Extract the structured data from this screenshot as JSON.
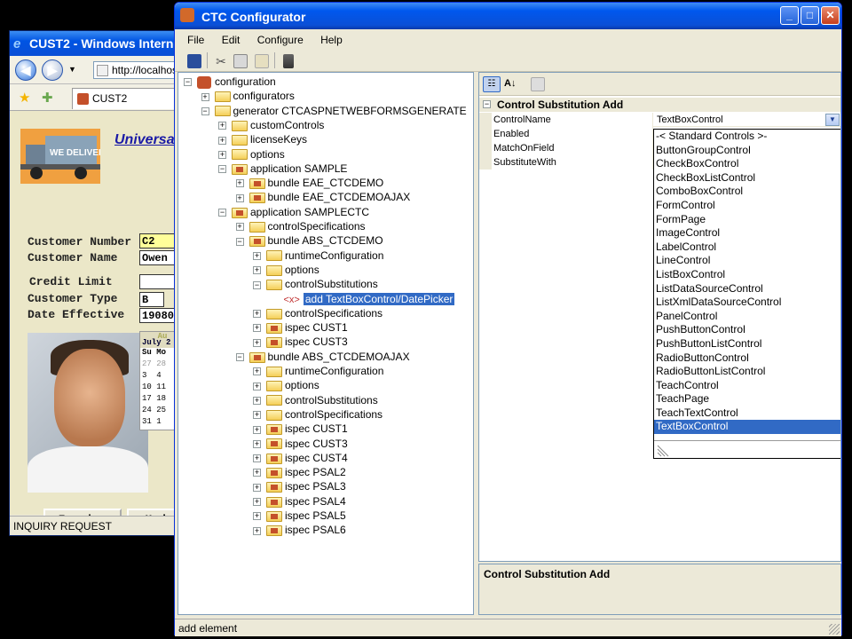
{
  "ie": {
    "title": "CUST2 - Windows Interne",
    "address": "http://localhost",
    "tab": "CUST2",
    "heading": "Universa",
    "fields": [
      {
        "label": "Customer Number",
        "value": "C2"
      },
      {
        "label": "Customer Name",
        "value": "Owen"
      },
      {
        "label": "Credit Limit",
        "value": ""
      },
      {
        "label": "Customer Type",
        "value": "B"
      },
      {
        "label": "Date Effective",
        "value": "19080"
      }
    ],
    "calendar": {
      "month": "Au",
      "month_year": "July 2",
      "rows": [
        "Su Mo",
        "27 28",
        "3  4",
        "10 11",
        "17 18",
        "24 25",
        "31 1"
      ]
    },
    "buttons": {
      "inquire": "Inquire",
      "update": "Updat"
    },
    "status": "INQUIRY REQUEST"
  },
  "ctc": {
    "title": "CTC Configurator",
    "menu": [
      "File",
      "Edit",
      "Configure",
      "Help"
    ],
    "tree": [
      {
        "label": "configuration",
        "indent": 0,
        "icon": "cfg",
        "pm": "−"
      },
      {
        "label": "configurators",
        "indent": 1,
        "icon": "fld",
        "pm": "+"
      },
      {
        "label": "generator CTCASPNETWEBFORMSGENERATE",
        "indent": 1,
        "icon": "fld",
        "pm": "−"
      },
      {
        "label": "customControls",
        "indent": 2,
        "icon": "fld",
        "pm": "+"
      },
      {
        "label": "licenseKeys",
        "indent": 2,
        "icon": "fld",
        "pm": "+"
      },
      {
        "label": "options",
        "indent": 2,
        "icon": "fld",
        "pm": "+"
      },
      {
        "label": "application SAMPLE",
        "indent": 2,
        "icon": "fldx",
        "pm": "−"
      },
      {
        "label": "bundle EAE_CTCDEMO",
        "indent": 3,
        "icon": "fldx",
        "pm": "+"
      },
      {
        "label": "bundle EAE_CTCDEMOAJAX",
        "indent": 3,
        "icon": "fldx",
        "pm": "+"
      },
      {
        "label": "application SAMPLECTC",
        "indent": 2,
        "icon": "fldx",
        "pm": "−"
      },
      {
        "label": "controlSpecifications",
        "indent": 3,
        "icon": "fld",
        "pm": "+"
      },
      {
        "label": "bundle ABS_CTCDEMO",
        "indent": 3,
        "icon": "fldx",
        "pm": "−"
      },
      {
        "label": "runtimeConfiguration",
        "indent": 4,
        "icon": "fld",
        "pm": "+"
      },
      {
        "label": "options",
        "indent": 4,
        "icon": "fld",
        "pm": "+"
      },
      {
        "label": "controlSubstitutions",
        "indent": 4,
        "icon": "fld",
        "pm": "−"
      },
      {
        "label": "add TextBoxControl/DatePicker",
        "indent": 5,
        "icon": "xml",
        "pm": "",
        "selected": true
      },
      {
        "label": "controlSpecifications",
        "indent": 4,
        "icon": "fld",
        "pm": "+"
      },
      {
        "label": "ispec CUST1",
        "indent": 4,
        "icon": "fldx",
        "pm": "+"
      },
      {
        "label": "ispec CUST3",
        "indent": 4,
        "icon": "fldx",
        "pm": "+"
      },
      {
        "label": "bundle ABS_CTCDEMOAJAX",
        "indent": 3,
        "icon": "fldx",
        "pm": "−"
      },
      {
        "label": "runtimeConfiguration",
        "indent": 4,
        "icon": "fld",
        "pm": "+"
      },
      {
        "label": "options",
        "indent": 4,
        "icon": "fld",
        "pm": "+"
      },
      {
        "label": "controlSubstitutions",
        "indent": 4,
        "icon": "fld",
        "pm": "+"
      },
      {
        "label": "controlSpecifications",
        "indent": 4,
        "icon": "fld",
        "pm": "+"
      },
      {
        "label": "ispec CUST1",
        "indent": 4,
        "icon": "fldx",
        "pm": "+"
      },
      {
        "label": "ispec CUST3",
        "indent": 4,
        "icon": "fldx",
        "pm": "+"
      },
      {
        "label": "ispec CUST4",
        "indent": 4,
        "icon": "fldx",
        "pm": "+"
      },
      {
        "label": "ispec PSAL2",
        "indent": 4,
        "icon": "fldx",
        "pm": "+"
      },
      {
        "label": "ispec PSAL3",
        "indent": 4,
        "icon": "fldx",
        "pm": "+"
      },
      {
        "label": "ispec PSAL4",
        "indent": 4,
        "icon": "fldx",
        "pm": "+"
      },
      {
        "label": "ispec PSAL5",
        "indent": 4,
        "icon": "fldx",
        "pm": "+"
      },
      {
        "label": "ispec PSAL6",
        "indent": 4,
        "icon": "fldx",
        "pm": "+"
      }
    ],
    "props": {
      "category": "Control Substitution Add",
      "rows": [
        {
          "name": "ControlName",
          "value": "TextBoxControl"
        },
        {
          "name": "Enabled",
          "value": ""
        },
        {
          "name": "MatchOnField",
          "value": ""
        },
        {
          "name": "SubstituteWith",
          "value": ""
        }
      ],
      "dropdown_options": [
        "-< Standard Controls >-",
        "ButtonGroupControl",
        "CheckBoxControl",
        "CheckBoxListControl",
        "ComboBoxControl",
        "FormControl",
        "FormPage",
        "ImageControl",
        "LabelControl",
        "LineControl",
        "ListBoxControl",
        "ListDataSourceControl",
        "ListXmlDataSourceControl",
        "PanelControl",
        "PushButtonControl",
        "PushButtonListControl",
        "RadioButtonControl",
        "RadioButtonListControl",
        "TeachControl",
        "TeachPage",
        "TeachTextControl",
        "TextBoxControl"
      ],
      "selected_option": "TextBoxControl",
      "description_title": "Control Substitution Add"
    },
    "status": "add element"
  },
  "colors": {
    "selection": "#316ac5",
    "titlebar": "#0058ee",
    "ie_page": "#ebe7c8"
  },
  "icons": [
    "save-icon",
    "cut-icon",
    "copy-icon",
    "paste-icon",
    "delete-icon",
    "categorized-icon",
    "alphabetical-icon",
    "property-pages-icon"
  ]
}
